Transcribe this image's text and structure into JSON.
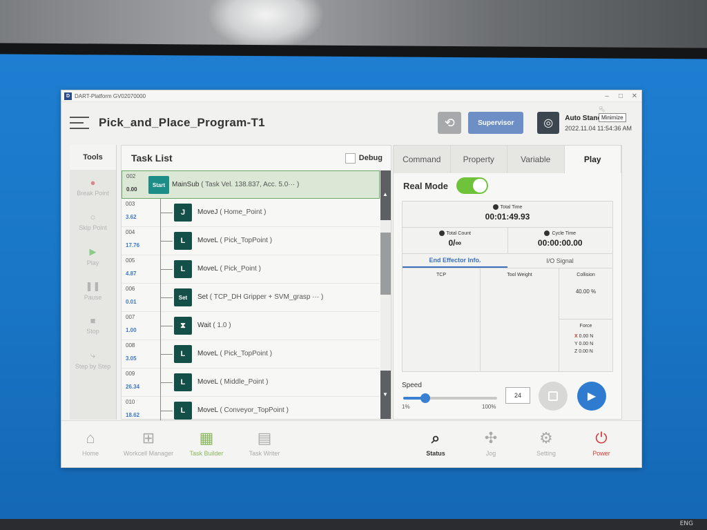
{
  "window": {
    "title": "DART-Platform GV02070000",
    "logo_letter": "D",
    "controls": [
      "–",
      "□",
      "✕"
    ],
    "tooltip": "Minimize"
  },
  "header": {
    "program_title": "Pick_and_Place_Program-T1",
    "supervisor_label": "Supervisor",
    "state": "Auto Standby",
    "datetime": "2022.11.04 11:54:36 AM"
  },
  "tools": {
    "heading": "Tools",
    "items": [
      {
        "label": "Break Point",
        "icon": "●"
      },
      {
        "label": "Skip Point",
        "icon": "○"
      },
      {
        "label": "Play",
        "icon": "▶"
      },
      {
        "label": "Pause",
        "icon": "❚❚"
      },
      {
        "label": "Stop",
        "icon": "■"
      },
      {
        "label": "Step by Step",
        "icon": "⤷"
      }
    ]
  },
  "tasklist": {
    "title": "Task List",
    "debug_label": "Debug",
    "rows": [
      {
        "line": "002",
        "time": "0.00",
        "icon": "Start",
        "cmd": "MainSub",
        "param": "( Task Vel. 138.837, Acc. 5.0··· )"
      },
      {
        "line": "003",
        "time": "3.62",
        "icon": "J",
        "cmd": "MoveJ",
        "param": "( Home_Point )"
      },
      {
        "line": "004",
        "time": "17.76",
        "icon": "L",
        "cmd": "MoveL",
        "param": "( Pick_TopPoint )"
      },
      {
        "line": "005",
        "time": "4.87",
        "icon": "L",
        "cmd": "MoveL",
        "param": "( Pick_Point )"
      },
      {
        "line": "006",
        "time": "0.01",
        "icon": "Set",
        "cmd": "Set",
        "param": "( TCP_DH Gripper + SVM_grasp ··· )"
      },
      {
        "line": "007",
        "time": "1.00",
        "icon": "⧗",
        "cmd": "Wait",
        "param": "( 1.0 )"
      },
      {
        "line": "008",
        "time": "3.05",
        "icon": "L",
        "cmd": "MoveL",
        "param": "( Pick_TopPoint )"
      },
      {
        "line": "009",
        "time": "26.34",
        "icon": "L",
        "cmd": "MoveL",
        "param": "( Middle_Point )"
      },
      {
        "line": "010",
        "time": "18.62",
        "icon": "L",
        "cmd": "MoveL",
        "param": "( Conveyor_TopPoint )"
      }
    ]
  },
  "right": {
    "tabs": [
      "Command",
      "Property",
      "Variable",
      "Play"
    ],
    "active_tab": "Play",
    "real_mode_label": "Real Mode",
    "total_time_label": "Total Time",
    "total_time": "00:01:49.93",
    "total_count_label": "Total Count",
    "total_count": "0/∞",
    "cycle_time_label": "Cycle Time",
    "cycle_time": "00:00:00.00",
    "subtabs": [
      "End Effector Info.",
      "I/O Signal"
    ],
    "tcp_label": "TCP",
    "tool_weight_label": "Tool Weight",
    "collision_label": "Collision",
    "collision_value": "40.00 %",
    "force_label": "Force",
    "force": [
      {
        "axis": "X",
        "value": "0.00 N"
      },
      {
        "axis": "Y",
        "value": "0.00 N"
      },
      {
        "axis": "Z",
        "value": "0.00 N"
      }
    ],
    "speed_label": "Speed",
    "speed_min": "1%",
    "speed_max": "100%",
    "speed_value": "24"
  },
  "nav": [
    {
      "label": "Home",
      "icon": "⌂"
    },
    {
      "label": "Workcell Manager",
      "icon": "⊞"
    },
    {
      "label": "Task Builder",
      "icon": "▦"
    },
    {
      "label": "Task Writer",
      "icon": "▤"
    },
    {
      "label": "Status",
      "icon": "⌕"
    },
    {
      "label": "Jog",
      "icon": "✣"
    },
    {
      "label": "Setting",
      "icon": "⚙"
    },
    {
      "label": "Power",
      "icon": "⏻"
    }
  ],
  "tray": "ENG",
  "colors": {
    "accent_blue": "#2f7bd0",
    "start_green": "#6aa664",
    "toggle_green": "#6fc33a",
    "task_icon": "#155048",
    "power_red": "#d23c3c"
  }
}
